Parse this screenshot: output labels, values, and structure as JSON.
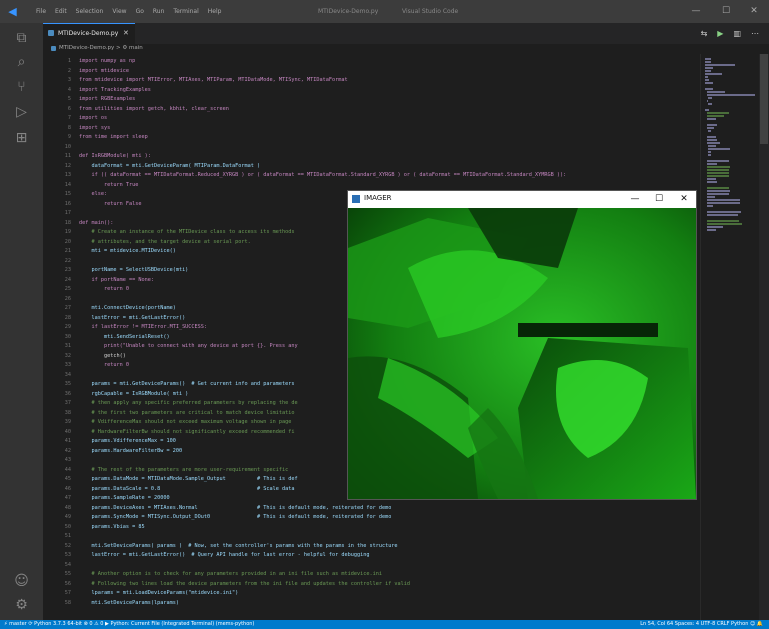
{
  "titlebar": {
    "menu": [
      "File",
      "Edit",
      "Selection",
      "View",
      "Go",
      "Run",
      "Terminal",
      "Help"
    ],
    "file_title": "MTIDevice-Demo.py",
    "app_title": "Visual Studio Code",
    "minimize": "—",
    "maximize": "☐",
    "close": "✕"
  },
  "tab": {
    "label": "MTIDevice-Demo.py",
    "close": "✕"
  },
  "tab_actions": [
    "⇆",
    "▶",
    "▥",
    "⋯"
  ],
  "breadcrumb": "MTIDevice-Demo.py > ⚙ main",
  "code": [
    {
      "n": "1",
      "t": "import numpy as np"
    },
    {
      "n": "2",
      "t": "import mtidevice"
    },
    {
      "n": "3",
      "t": "from mtidevice import MTIError, MTIAxes, MTIParam, MTIDataMode, MTISync, MTIDataFormat"
    },
    {
      "n": "4",
      "t": "import TrackingExamples"
    },
    {
      "n": "5",
      "t": "import RGBExamples"
    },
    {
      "n": "6",
      "t": "from utilities import getch, kbhit, clear_screen"
    },
    {
      "n": "7",
      "t": "import os"
    },
    {
      "n": "8",
      "t": "import sys"
    },
    {
      "n": "9",
      "t": "from time import sleep"
    },
    {
      "n": "10",
      "t": ""
    },
    {
      "n": "11",
      "t": "def IsRGBModule( mti ):"
    },
    {
      "n": "12",
      "t": "    dataFormat = mti.GetDeviceParam( MTIParam.DataFormat )"
    },
    {
      "n": "13",
      "t": "    if (( dataFormat == MTIDataFormat.Reduced_XYRGB ) or ( dataFormat == MTIDataFormat.Standard_XYRGB ) or ( dataFormat == MTIDataFormat.Standard_XYMRGB )):"
    },
    {
      "n": "14",
      "t": "        return True"
    },
    {
      "n": "15",
      "t": "    else:"
    },
    {
      "n": "16",
      "t": "        return False"
    },
    {
      "n": "17",
      "t": ""
    },
    {
      "n": "18",
      "t": "def main():"
    },
    {
      "n": "19",
      "t": "    # Create an instance of the MTIDevice class to access its methods"
    },
    {
      "n": "20",
      "t": "    # attributes, and the target device at serial port."
    },
    {
      "n": "21",
      "t": "    mti = mtidevice.MTIDevice()"
    },
    {
      "n": "22",
      "t": ""
    },
    {
      "n": "23",
      "t": "    portName = SelectUSBDevice(mti)"
    },
    {
      "n": "24",
      "t": "    if portName == None:"
    },
    {
      "n": "25",
      "t": "        return 0"
    },
    {
      "n": "26",
      "t": ""
    },
    {
      "n": "27",
      "t": "    mti.ConnectDevice(portName)"
    },
    {
      "n": "28",
      "t": "    lastError = mti.GetLastError()"
    },
    {
      "n": "29",
      "t": "    if lastError != MTIError.MTI_SUCCESS:"
    },
    {
      "n": "30",
      "t": "        mti.SendSerialReset()"
    },
    {
      "n": "31",
      "t": "        print(\"Unable to connect with any device at port {}. Press any"
    },
    {
      "n": "32",
      "t": "        getch()"
    },
    {
      "n": "33",
      "t": "        return 0"
    },
    {
      "n": "34",
      "t": ""
    },
    {
      "n": "35",
      "t": "    params = mti.GetDeviceParams()  # Get current info and parameters"
    },
    {
      "n": "36",
      "t": "    rgbCapable = IsRGBModule( mti )"
    },
    {
      "n": "37",
      "t": "    # then apply any specific preferred parameters by replacing the de"
    },
    {
      "n": "38",
      "t": "    # the first two parameters are critical to match device limitatio"
    },
    {
      "n": "39",
      "t": "    # VdifferenceMax should not exceed maximum voltage shown in page"
    },
    {
      "n": "40",
      "t": "    # HardwareFilterBw should not significantly exceed recommended fi"
    },
    {
      "n": "41",
      "t": "    params.VdifferenceMax = 100"
    },
    {
      "n": "42",
      "t": "    params.HardwareFilterBw = 200"
    },
    {
      "n": "43",
      "t": ""
    },
    {
      "n": "44",
      "t": "    # The rest of the parameters are more user-requirement specific"
    },
    {
      "n": "45",
      "t": "    params.DataMode = MTIDataMode.Sample_Output          # This is def"
    },
    {
      "n": "46",
      "t": "    params.DataScale = 0.8                               # Scale data"
    },
    {
      "n": "47",
      "t": "    params.SampleRate = 20000"
    },
    {
      "n": "48",
      "t": "    params.DeviceAxes = MTIAxes.Normal                   # This is default mode, reiterated for demo"
    },
    {
      "n": "49",
      "t": "    params.SyncMode = MTISync.Output_DOut0               # This is default mode, reiterated for demo"
    },
    {
      "n": "50",
      "t": "    params.Vbias = 85"
    },
    {
      "n": "51",
      "t": ""
    },
    {
      "n": "52",
      "t": "    mti.SetDeviceParams( params )  # Now, set the controller's params with the params in the structure"
    },
    {
      "n": "53",
      "t": "    lastError = mti.GetLastError()  # Query API handle for last error - helpful for debugging"
    },
    {
      "n": "54",
      "t": ""
    },
    {
      "n": "55",
      "t": "    # Another option is to check for any parameters provided in an ini file such as mtidevice.ini"
    },
    {
      "n": "56",
      "t": "    # Following two lines load the device parameters from the ini file and updates the controller if valid"
    },
    {
      "n": "57",
      "t": "    lparams = mti.LoadDeviceParams(\"mtidevice.ini\")"
    },
    {
      "n": "58",
      "t": "    mti.SetDeviceParams(lparams)"
    }
  ],
  "imager": {
    "title": "IMAGER",
    "minimize": "—",
    "maximize": "☐",
    "close": "✕"
  },
  "statusbar": {
    "left": "⚡ master  ⟳  Python 3.7.3 64-bit  ⊗ 0 ⚠ 0  ▶ Python: Current File (Integrated Terminal) (mems-python)",
    "right": "Ln 54, Col 64   Spaces: 4   UTF-8   CRLF   Python   ☺   🔔"
  },
  "colors": {
    "accent": "#007acc",
    "editor_bg": "#1e1e1e",
    "imager_green": "#22c41e"
  }
}
